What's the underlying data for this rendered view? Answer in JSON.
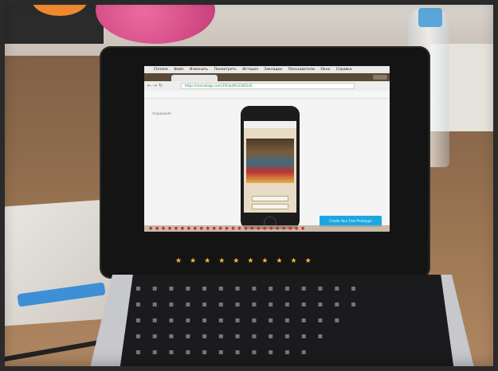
{
  "browser": {
    "menubar": [
      "Chrome",
      "Файл",
      "Изменить",
      "Посмотреть",
      "История",
      "Закладки",
      "Пользователи",
      "Окно",
      "Справка"
    ],
    "url": "https://marvelapp.com/1f33a4#12185142"
  },
  "page": {
    "prototype_label": "Vnpakaam",
    "cta_button": "Create Your Free Prototype"
  }
}
